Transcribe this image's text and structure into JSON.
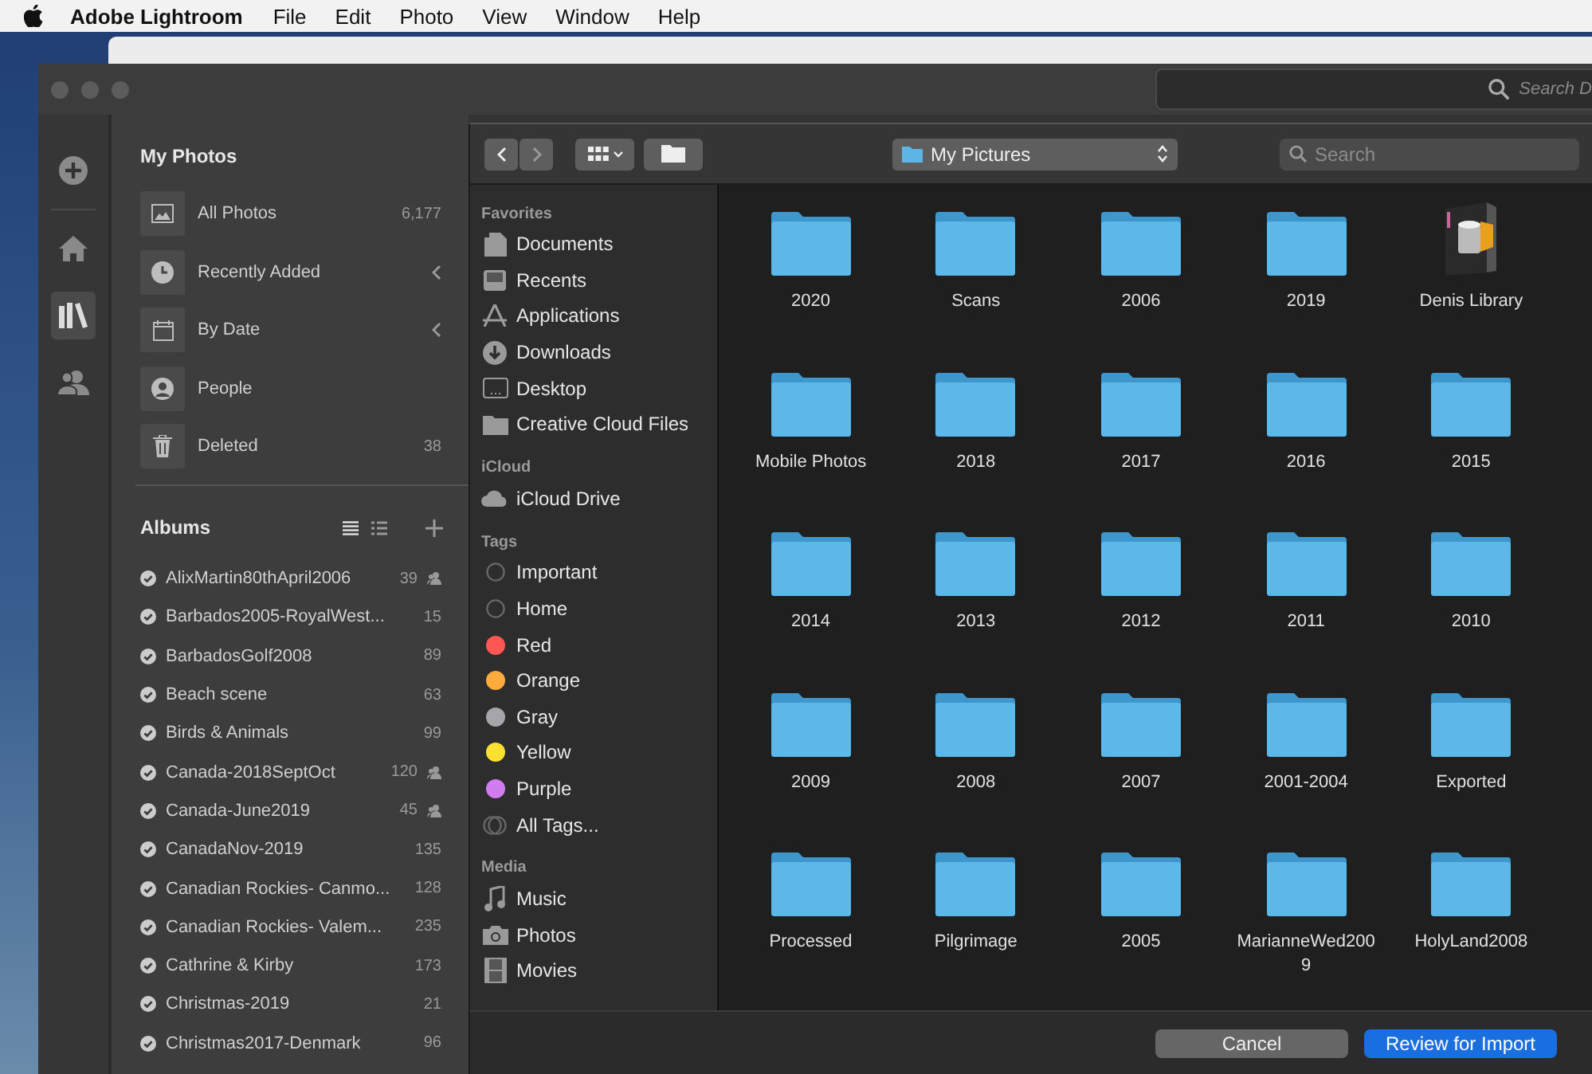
{
  "menubar": {
    "app": "Adobe Lightroom",
    "menus": [
      "File",
      "Edit",
      "Photo",
      "View",
      "Window",
      "Help"
    ]
  },
  "lightroom": {
    "search_placeholder": "Search D",
    "rail": [
      {
        "kind": "add",
        "selected": false
      },
      {
        "kind": "home",
        "selected": false
      },
      {
        "kind": "library",
        "selected": true
      },
      {
        "kind": "people",
        "selected": false
      }
    ],
    "my_photos": {
      "title": "My Photos",
      "items": [
        {
          "kind": "photo",
          "label": "All Photos",
          "count": "6,177",
          "expandable": false
        },
        {
          "kind": "clock",
          "label": "Recently Added",
          "expandable": true
        },
        {
          "kind": "calendar",
          "label": "By Date",
          "expandable": true
        },
        {
          "kind": "person",
          "label": "People",
          "expandable": false
        },
        {
          "kind": "trash",
          "label": "Deleted",
          "count": "38",
          "expandable": false
        }
      ]
    },
    "albums": {
      "title": "Albums",
      "items": [
        {
          "name": "AlixMartin80thApril2006",
          "count": "39",
          "shared": true
        },
        {
          "name": "Barbados2005-RoyalWest...",
          "count": "15",
          "shared": false
        },
        {
          "name": "BarbadosGolf2008",
          "count": "89",
          "shared": false
        },
        {
          "name": "Beach scene",
          "count": "63",
          "shared": false
        },
        {
          "name": "Birds & Animals",
          "count": "99",
          "shared": false
        },
        {
          "name": "Canada-2018SeptOct",
          "count": "120",
          "shared": true
        },
        {
          "name": "Canada-June2019",
          "count": "45",
          "shared": true
        },
        {
          "name": "CanadaNov-2019",
          "count": "135",
          "shared": false
        },
        {
          "name": "Canadian Rockies- Canmo...",
          "count": "128",
          "shared": false
        },
        {
          "name": "Canadian Rockies- Valem...",
          "count": "235",
          "shared": false
        },
        {
          "name": "Cathrine & Kirby",
          "count": "173",
          "shared": false
        },
        {
          "name": "Christmas-2019",
          "count": "21",
          "shared": false
        },
        {
          "name": "Christmas2017-Denmark",
          "count": "96",
          "shared": false
        }
      ]
    }
  },
  "dialog": {
    "location": "My Pictures",
    "search_placeholder": "Search",
    "sidebar": [
      {
        "title": "Favorites",
        "items": [
          {
            "kind": "documents",
            "label": "Documents"
          },
          {
            "kind": "recents",
            "label": "Recents"
          },
          {
            "kind": "applications",
            "label": "Applications"
          },
          {
            "kind": "downloads",
            "label": "Downloads"
          },
          {
            "kind": "desktop",
            "label": "Desktop"
          },
          {
            "kind": "folder",
            "label": "Creative Cloud Files"
          }
        ]
      },
      {
        "title": "iCloud",
        "items": [
          {
            "kind": "cloud",
            "label": "iCloud Drive"
          }
        ]
      },
      {
        "title": "Tags",
        "items": [
          {
            "kind": "tag-outline",
            "label": "Important"
          },
          {
            "kind": "tag-outline",
            "label": "Home"
          },
          {
            "kind": "tag",
            "label": "Red",
            "color": "#fc5753"
          },
          {
            "kind": "tag",
            "label": "Orange",
            "color": "#fdab3c"
          },
          {
            "kind": "tag",
            "label": "Gray",
            "color": "#a5a5aa"
          },
          {
            "kind": "tag",
            "label": "Yellow",
            "color": "#fbe12f"
          },
          {
            "kind": "tag",
            "label": "Purple",
            "color": "#d17cf1"
          },
          {
            "kind": "all-tags",
            "label": "All Tags..."
          }
        ]
      },
      {
        "title": "Media",
        "items": [
          {
            "kind": "music",
            "label": "Music"
          },
          {
            "kind": "camera",
            "label": "Photos"
          },
          {
            "kind": "film",
            "label": "Movies"
          }
        ]
      }
    ],
    "files": [
      {
        "name": "2020",
        "kind": "folder"
      },
      {
        "name": "Scans",
        "kind": "folder"
      },
      {
        "name": "2006",
        "kind": "folder"
      },
      {
        "name": "2019",
        "kind": "folder"
      },
      {
        "name": "Denis Library",
        "kind": "library"
      },
      {
        "name": "Mobile Photos",
        "kind": "folder"
      },
      {
        "name": "2018",
        "kind": "folder"
      },
      {
        "name": "2017",
        "kind": "folder"
      },
      {
        "name": "2016",
        "kind": "folder"
      },
      {
        "name": "2015",
        "kind": "folder"
      },
      {
        "name": "2014",
        "kind": "folder"
      },
      {
        "name": "2013",
        "kind": "folder"
      },
      {
        "name": "2012",
        "kind": "folder"
      },
      {
        "name": "2011",
        "kind": "folder"
      },
      {
        "name": "2010",
        "kind": "folder"
      },
      {
        "name": "2009",
        "kind": "folder"
      },
      {
        "name": "2008",
        "kind": "folder"
      },
      {
        "name": "2007",
        "kind": "folder"
      },
      {
        "name": "2001-2004",
        "kind": "folder"
      },
      {
        "name": "Exported",
        "kind": "folder"
      },
      {
        "name": "Processed",
        "kind": "folder"
      },
      {
        "name": "Pilgrimage",
        "kind": "folder"
      },
      {
        "name": "2005",
        "kind": "folder"
      },
      {
        "name": "MarianneWed2009",
        "kind": "folder"
      },
      {
        "name": "HolyLand2008",
        "kind": "folder"
      }
    ],
    "buttons": [
      {
        "label": "Cancel",
        "kind": "secondary"
      },
      {
        "label": "Review for Import",
        "kind": "primary"
      }
    ]
  }
}
